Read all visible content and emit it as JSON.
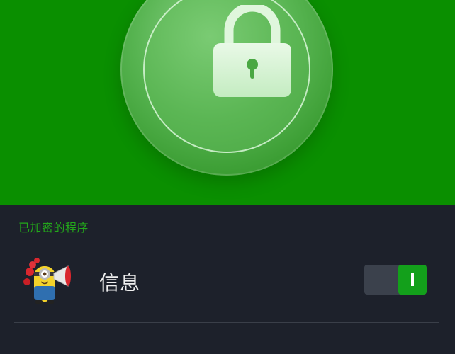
{
  "hero": {
    "icon": "padlock-icon",
    "background_color": "#0a8f00"
  },
  "section": {
    "title": "已加密的程序"
  },
  "apps": [
    {
      "name": "信息",
      "icon": "minion-app-icon",
      "locked": true
    }
  ],
  "colors": {
    "accent": "#13a01b",
    "background": "#1d212b",
    "toggle_off": "#3b414c"
  }
}
